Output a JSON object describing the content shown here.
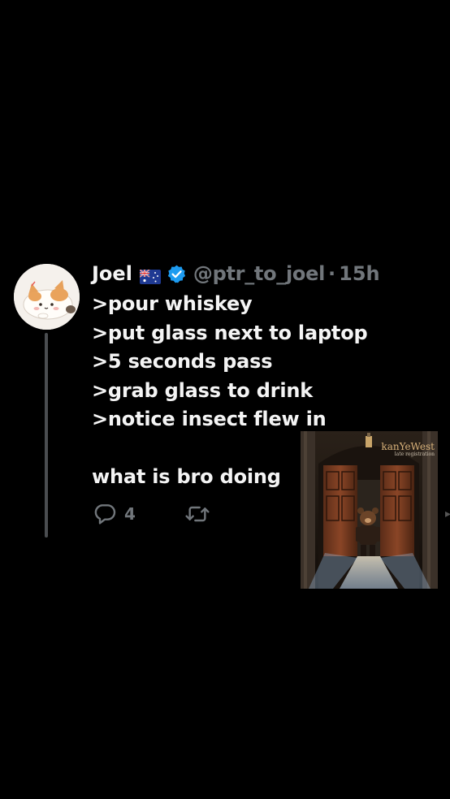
{
  "tweet": {
    "name": "Joel",
    "handle": "@ptr_to_joel",
    "separator": "·",
    "time": "15h",
    "lines": [
      ">pour whiskey",
      ">put glass next to laptop",
      ">5 seconds pass",
      ">grab glass to drink",
      ">notice insect flew in"
    ],
    "closing": "what is bro doing",
    "replies": "4"
  },
  "album": {
    "artist": "kanYeWest",
    "title": "late registration"
  },
  "colors": {
    "background": "#000000",
    "text": "#f4f4f4",
    "muted": "#71767b",
    "verified": "#1d9bf0",
    "thread_line": "#4a4d50"
  },
  "icons": {
    "flag": "australia-flag-icon",
    "verified": "verified-badge-icon",
    "reply": "reply-icon",
    "retweet": "retweet-icon"
  }
}
